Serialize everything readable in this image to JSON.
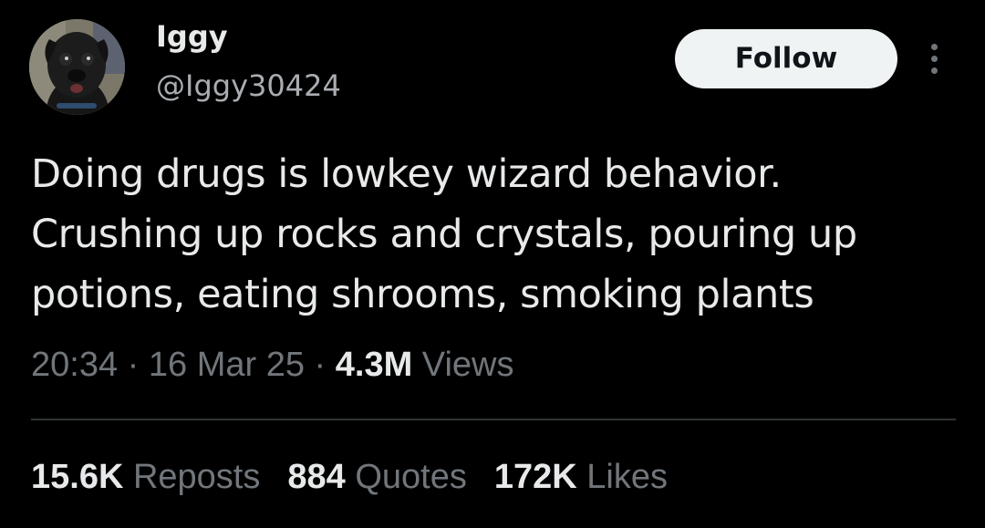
{
  "user": {
    "display_name": "Iggy",
    "handle": "@Iggy30424",
    "avatar_icon": "pug-avatar"
  },
  "actions": {
    "follow_label": "Follow",
    "more_icon": "more-vertical-icon"
  },
  "tweet": {
    "text": "Doing drugs is lowkey wizard behavior.\nCrushing up rocks and crystals, pouring up\npotions, eating shrooms, smoking plants"
  },
  "meta": {
    "time": "20:34",
    "separator": " · ",
    "date": "16 Mar 25",
    "views_count": "4.3M",
    "views_label": " Views"
  },
  "stats": {
    "reposts_count": "15.6K",
    "reposts_label": " Reposts",
    "quotes_count": "884",
    "quotes_label": " Quotes",
    "likes_count": "172K",
    "likes_label": " Likes"
  },
  "colors": {
    "background": "#000000",
    "primary_text": "#e7e9ea",
    "secondary_text": "#71767b",
    "follow_button_bg": "#eff3f4",
    "divider": "#2f3336"
  }
}
